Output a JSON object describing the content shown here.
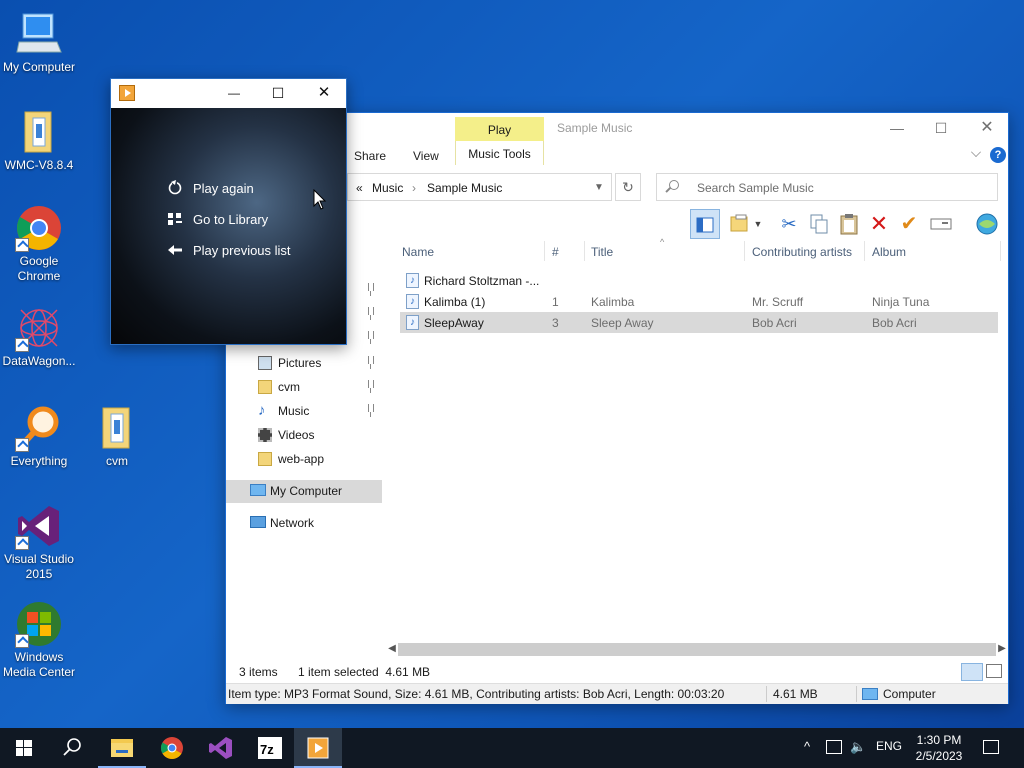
{
  "desktop": {
    "icons": [
      {
        "label": "My Computer"
      },
      {
        "label": "WMC-V8.8.4"
      },
      {
        "label": "Google Chrome"
      },
      {
        "label": "DataWagon..."
      },
      {
        "label": "Everything"
      },
      {
        "label": "cvm"
      },
      {
        "label": "Visual Studio 2015"
      },
      {
        "label": "Windows Media Center"
      }
    ]
  },
  "player": {
    "menu": [
      {
        "label": "Play again",
        "icon": "replay-icon"
      },
      {
        "label": "Go to Library",
        "icon": "library-icon"
      },
      {
        "label": "Play previous list",
        "icon": "back-arrow-icon"
      }
    ],
    "controls": {
      "minimize": "—",
      "maximize": "☐",
      "close": "✕"
    }
  },
  "explorer": {
    "context_tab": "Play",
    "context_group": "Music Tools",
    "window_title": "Sample Music",
    "ribbon_tabs": [
      "Share",
      "View"
    ],
    "address": {
      "overflow": "«",
      "segments": [
        "Music",
        "Sample Music"
      ]
    },
    "search_placeholder": "Search Sample Music",
    "columns": [
      "Name",
      "#",
      "Title",
      "Contributing artists",
      "Album"
    ],
    "files": [
      {
        "name": "Richard Stoltzman -...",
        "num": "",
        "title": "",
        "artist": "",
        "album": "",
        "selected": false
      },
      {
        "name": "Kalimba (1)",
        "num": "1",
        "title": "Kalimba",
        "artist": "Mr. Scruff",
        "album": "Ninja Tuna",
        "selected": false
      },
      {
        "name": "SleepAway",
        "num": "3",
        "title": "Sleep Away",
        "artist": "Bob Acri",
        "album": "Bob Acri",
        "selected": true
      }
    ],
    "nav": [
      {
        "label": "Pictures",
        "pinned": true
      },
      {
        "label": "cvm",
        "pinned": true
      },
      {
        "label": "Music",
        "pinned": true
      },
      {
        "label": "Videos",
        "pinned": false
      },
      {
        "label": "web-app",
        "pinned": false
      },
      {
        "label": "My Computer",
        "pinned": false
      },
      {
        "label": "Network",
        "pinned": false
      }
    ],
    "status": {
      "count": "3 items",
      "selection": "1 item selected  4.61 MB"
    },
    "details": {
      "info": "Item type: MP3 Format Sound, Size: 4.61 MB, Contributing artists: Bob Acri, Length: 00:03:20",
      "size": "4.61 MB",
      "location": "Computer"
    }
  },
  "taskbar": {
    "language": "ENG",
    "time": "1:30 PM",
    "date": "2/5/2023"
  },
  "colors": {
    "desktop": "#1565c8",
    "accent": "#1a6ad1",
    "ribbon_context": "#f4ef8a",
    "taskbar": "#101823"
  }
}
